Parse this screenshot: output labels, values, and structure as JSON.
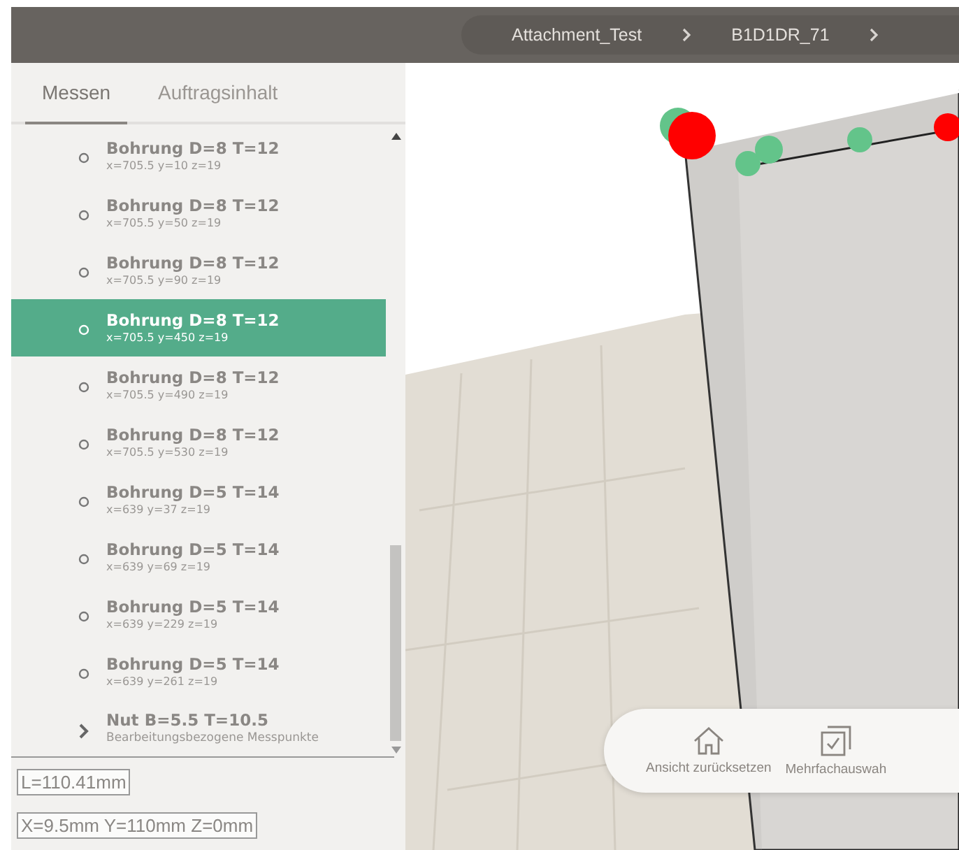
{
  "breadcrumb": [
    "Attachment_Test",
    "B1D1DR_71"
  ],
  "tabs": [
    {
      "label": "Messen",
      "selected": true
    },
    {
      "label": "Auftragsinhalt",
      "selected": false
    }
  ],
  "items": [
    {
      "kind": "point",
      "title": "Bohrung D=8 T=12",
      "detail": "x=705.5 y=10 z=19",
      "selected": false
    },
    {
      "kind": "point",
      "title": "Bohrung D=8 T=12",
      "detail": "x=705.5 y=50 z=19",
      "selected": false
    },
    {
      "kind": "point",
      "title": "Bohrung D=8 T=12",
      "detail": "x=705.5 y=90 z=19",
      "selected": false
    },
    {
      "kind": "point",
      "title": "Bohrung D=8 T=12",
      "detail": "x=705.5 y=450 z=19",
      "selected": true
    },
    {
      "kind": "point",
      "title": "Bohrung D=8 T=12",
      "detail": "x=705.5 y=490 z=19",
      "selected": false
    },
    {
      "kind": "point",
      "title": "Bohrung D=8 T=12",
      "detail": "x=705.5 y=530 z=19",
      "selected": false
    },
    {
      "kind": "point",
      "title": "Bohrung D=5 T=14",
      "detail": "x=639 y=37 z=19",
      "selected": false
    },
    {
      "kind": "point",
      "title": "Bohrung D=5 T=14",
      "detail": "x=639 y=69 z=19",
      "selected": false
    },
    {
      "kind": "point",
      "title": "Bohrung D=5 T=14",
      "detail": "x=639 y=229 z=19",
      "selected": false
    },
    {
      "kind": "point",
      "title": "Bohrung D=5 T=14",
      "detail": "x=639 y=261 z=19",
      "selected": false
    },
    {
      "kind": "group",
      "title": "Nut B=5.5 T=10.5",
      "detail": "Bearbeitungsbezogene Messpunkte",
      "selected": false
    }
  ],
  "length": "L=110.41mm",
  "position": "X=9.5mm Y=110mm Z=0mm",
  "toolbar": [
    {
      "kind": "home",
      "label": "Ansicht zurücksetzen"
    },
    {
      "kind": "multi",
      "label": "Mehrfachauswah"
    }
  ]
}
